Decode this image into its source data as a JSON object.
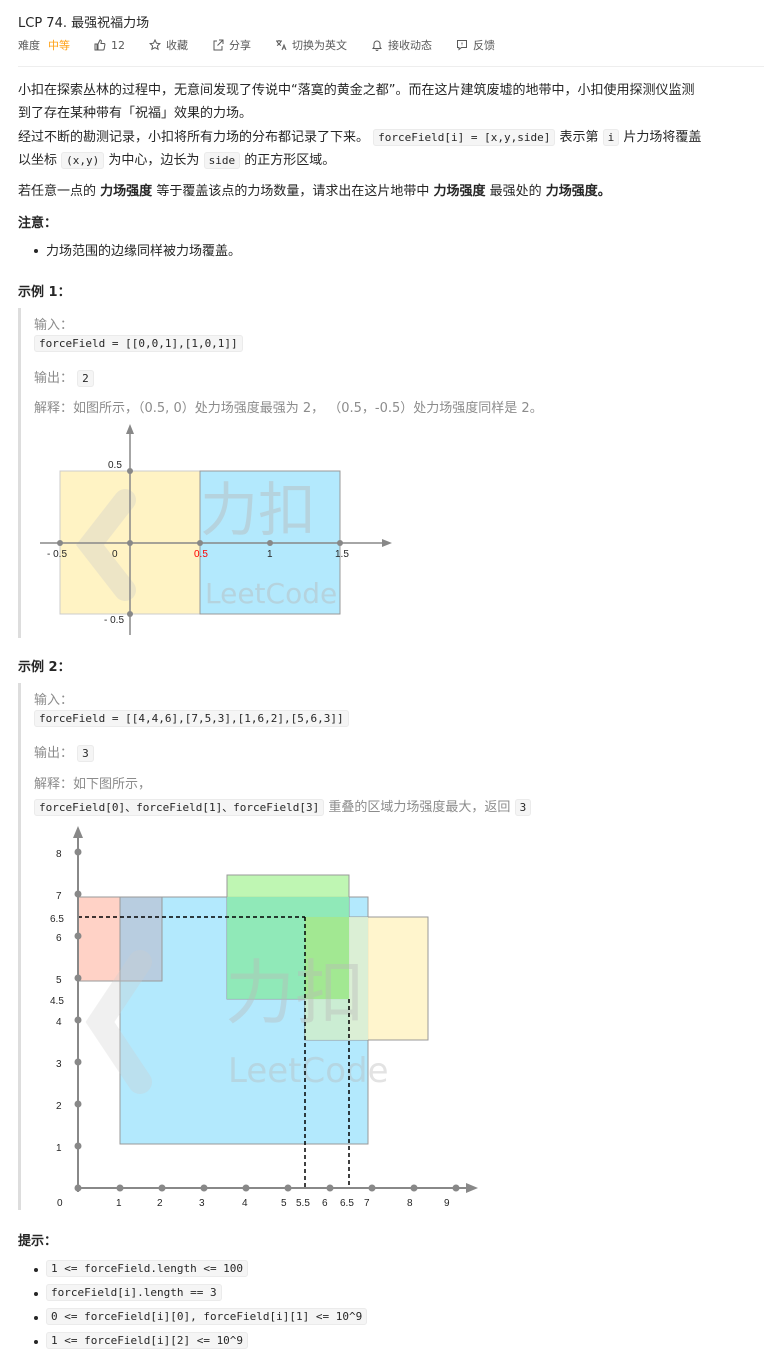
{
  "header": {
    "title": "LCP 74. 最强祝福力场",
    "difficulty_label": "难度",
    "difficulty": "中等",
    "likes": "12",
    "favorite": "收藏",
    "share": "分享",
    "switch_lang": "切换为英文",
    "subscribe": "接收动态",
    "feedback": "反馈"
  },
  "description": {
    "p1a": "小扣在探索丛林的过程中，无意间发现了传说中“落寞的黄金之都”。而在这片建筑废墟的地带中，小扣使用探测仪监测",
    "p1b": "到了存在某种带有「祝福」效果的力场。",
    "p2_a": "经过不断的勘测记录，小扣将所有力场的分布都记录了下来。",
    "p2_code1": "forceField[i] = [x,y,side]",
    "p2_b": "表示第",
    "p2_code2": "i",
    "p2_c": "片力场将覆盖",
    "p3_a": "以坐标",
    "p3_code1": "(x,y)",
    "p3_b": "为中心，边长为",
    "p3_code2": "side",
    "p3_c": "的正方形区域。",
    "p4_a": "若任意一点的",
    "p4_b1": "力场强度",
    "p4_c": "等于覆盖该点的力场数量，请求出在这片地带中",
    "p4_b2": "力场强度",
    "p4_d": "最强处的",
    "p4_b3": "力场强度。",
    "note_title": "注意：",
    "note_item": "力场范围的边缘同样被力场覆盖。"
  },
  "example1": {
    "title": "示例 1：",
    "input_label": "输入：",
    "input": "forceField = [[0,0,1],[1,0,1]]",
    "output_label": "输出：",
    "output": "2",
    "explain": "解释：如图所示，（0.5, 0）处力场强度最强为 2，  （0.5，-0.5）处力场强度同样是 2。"
  },
  "figure1": {
    "ticks_x": [
      "- 0.5",
      "0",
      "0.5",
      "1",
      "1.5"
    ],
    "ticks_y": [
      "0.5",
      "- 0.5"
    ],
    "watermark_cn": "力扣",
    "watermark_en": "LeetCode"
  },
  "example2": {
    "title": "示例 2：",
    "input_label": "输入：",
    "input": "forceField = [[4,4,6],[7,5,3],[1,6,2],[5,6,3]]",
    "output_label": "输出：",
    "output": "3",
    "explain_a": "解释：如下图所示，",
    "explain_code": "forceField[0]、forceField[1]、forceField[3]",
    "explain_b": "重叠的区域力场强度最大，返回",
    "explain_code2": "3"
  },
  "figure2": {
    "ticks_x": [
      "0",
      "1",
      "2",
      "3",
      "4",
      "5",
      "5.5",
      "6",
      "6.5",
      "7",
      "8",
      "9"
    ],
    "ticks_y": [
      "8",
      "7",
      "6.5",
      "6",
      "5",
      "4.5",
      "4",
      "3",
      "2",
      "1"
    ],
    "watermark_cn": "力扣",
    "watermark_en": "LeetCode"
  },
  "hints": {
    "title": "提示：",
    "items": [
      "1 <= forceField.length <= 100",
      "forceField[i].length == 3",
      "0 <= forceField[i][0], forceField[i][1] <= 10^9",
      "1 <= forceField[i][2] <= 10^9"
    ]
  },
  "colors": {
    "difficulty": "#ffa116",
    "yellow_field": "#fff3c4",
    "blue_field": "#b3e9fd",
    "red_tick": "#ff0000",
    "quote_bar": "#dddddd"
  }
}
